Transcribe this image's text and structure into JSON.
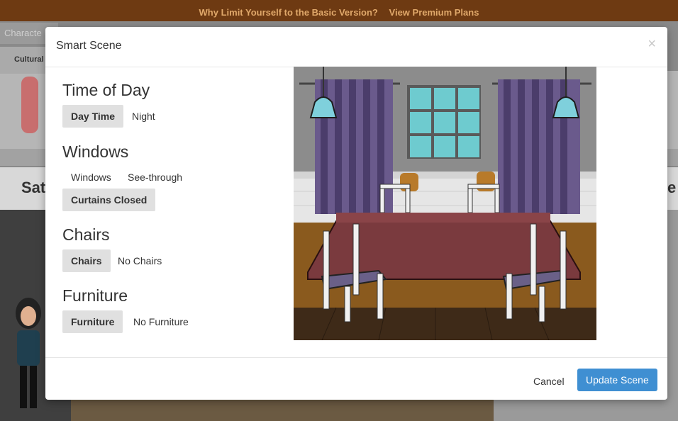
{
  "banner": {
    "text": "Why Limit Yourself to the Basic Version?",
    "link": "View Premium Plans"
  },
  "background": {
    "tab_label": "Characte",
    "category_label": "Cultural",
    "band_label_left": "Sat",
    "band_label_right": "e"
  },
  "modal": {
    "title": "Smart Scene",
    "close_symbol": "×",
    "sections": {
      "time_of_day": {
        "title": "Time of Day",
        "options": [
          "Day Time",
          "Night"
        ],
        "selected": "Day Time"
      },
      "windows": {
        "title": "Windows",
        "options": [
          "Windows",
          "See-through",
          "Curtains Closed"
        ],
        "selected": "Curtains Closed"
      },
      "chairs": {
        "title": "Chairs",
        "options": [
          "Chairs",
          "No Chairs"
        ],
        "selected": "Chairs"
      },
      "furniture": {
        "title": "Furniture",
        "options": [
          "Furniture",
          "No Furniture"
        ],
        "selected": "Furniture"
      }
    },
    "footer": {
      "cancel_label": "Cancel",
      "update_label": "Update Scene"
    }
  },
  "colors": {
    "banner_bg": "#6e3a12",
    "banner_text": "#e0a86a",
    "primary_button": "#3f8fd2",
    "selected_option_bg": "#e0e0e0"
  }
}
